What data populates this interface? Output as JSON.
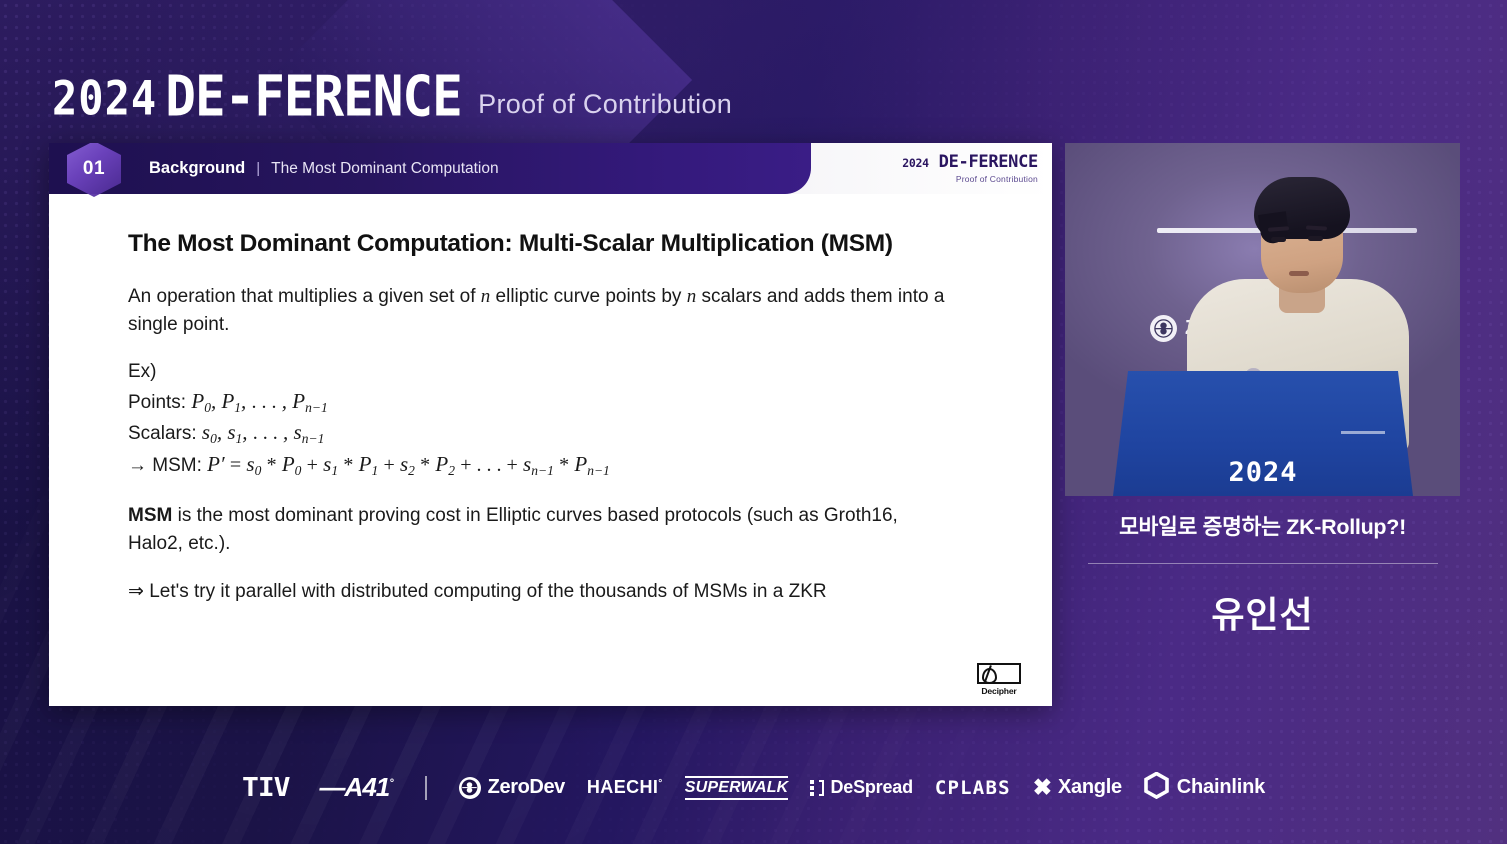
{
  "brand": {
    "year": "2024",
    "name": "DE-FERENCE",
    "tagline": "Proof of Contribution"
  },
  "slide": {
    "header": {
      "number": "01",
      "category": "Background",
      "separator": "|",
      "subtitle": "The Most Dominant Computation",
      "logo_year": "2024",
      "logo_name": "DE-FERENCE",
      "logo_sub": "Proof of Contribution"
    },
    "title": "The Most Dominant Computation: Multi-Scalar Multiplication (MSM)",
    "intro_a": "An operation that multiplies a given set of ",
    "intro_var1": "n",
    "intro_b": " elliptic curve points by ",
    "intro_var2": "n",
    "intro_c": " scalars and adds them into a single point.",
    "ex_label": "Ex)",
    "points_label": "Points:",
    "points_math": "P₀, P₁, …, Pₙ₋₁",
    "scalars_label": "Scalars:",
    "scalars_math": "s₀, s₁, …, sₙ₋₁",
    "msm_arrow": "→",
    "msm_label": "MSM:",
    "msm_math": "P′ = s₀ * P₀ + s₁ * P₁ + s₂ * P₂ + … + sₙ₋₁ * Pₙ₋₁",
    "cost_bold": "MSM",
    "cost_rest": " is the most dominant proving cost in Elliptic curves based protocols (such as Groth16, Halo2, etc.).",
    "conclusion": "⇒ Let's try it parallel with distributed computing of the thousands of MSMs in a ZKR",
    "decipher_label": "Decipher"
  },
  "video": {
    "backdrop_logo": "ZeroDev",
    "podium_year": "2024"
  },
  "caption": {
    "title": "모바일로 증명하는 ZK-Rollup?!",
    "speaker": "유인선"
  },
  "footer": {
    "tiv": "TIV",
    "a41": "A41",
    "a41_mark": "°",
    "zerodev": "ZeroDev",
    "haechi": "HAECHI",
    "haechi_mark": "°",
    "superwalk": "SUPERWALK",
    "despread": "DeSpread",
    "cplabs": "CPLABS",
    "xangle": "Xangle",
    "chainlink": "Chainlink"
  },
  "colors": {
    "bg_navy": "#1a1245",
    "bg_purple": "#4a2a85",
    "header_dark": "#27155e",
    "accent_purple": "#6e44c0",
    "podium_blue": "#2750ad",
    "slide_white": "#ffffff"
  }
}
